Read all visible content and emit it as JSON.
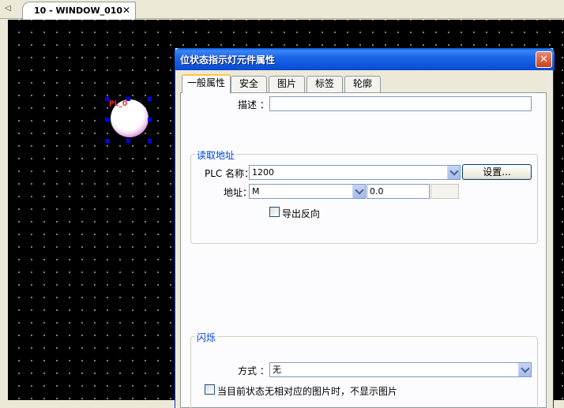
{
  "document_tab": {
    "label": "10 - WINDOW_010",
    "close_glyph": "✕",
    "scroll_glyph": "◁"
  },
  "canvas": {
    "indicator": {
      "label": "PL_0",
      "colors": {
        "face": "#ffffff",
        "ring": "#c77bd9",
        "label": "#ff2020",
        "handles": "#0000ff"
      }
    }
  },
  "dialog": {
    "title": "位状态指示灯元件属性",
    "close_icon": "close-icon",
    "tabs": [
      {
        "label": "一般属性",
        "active": true
      },
      {
        "label": "安全",
        "active": false
      },
      {
        "label": "图片",
        "active": false
      },
      {
        "label": "标签",
        "active": false
      },
      {
        "label": "轮廓",
        "active": false
      }
    ],
    "description": {
      "label": "描述 ：",
      "value": ""
    },
    "read_address": {
      "group_title": "读取地址",
      "plc_name_label": "PLC 名称：",
      "plc_name_value": "1200",
      "settings_button": "设置...",
      "address_label": "地址：",
      "address_type_value": "M",
      "address_value": "0.0",
      "invert_output": {
        "label": "导出反向",
        "checked": false
      }
    },
    "blink": {
      "group_title": "闪烁",
      "mode_label": "方式 ：",
      "mode_value": "无"
    },
    "no_image_option": {
      "label": "当目前状态无相对应的图片时，不显示图片",
      "checked": false
    }
  }
}
